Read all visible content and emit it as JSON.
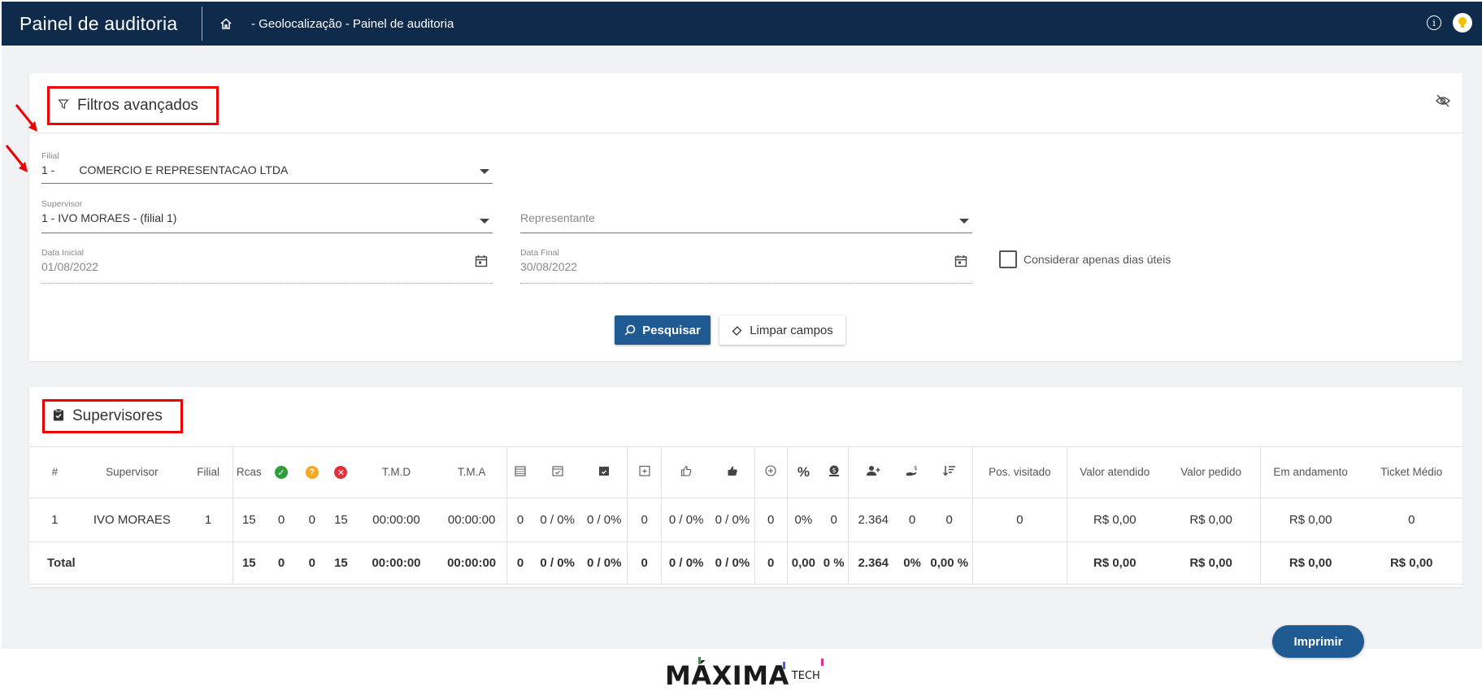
{
  "header": {
    "title": "Painel de auditoria",
    "breadcrumb": "- Geolocalização - Painel de auditoria",
    "bg_color": "#0f2b4c"
  },
  "filters": {
    "title": "Filtros avançados",
    "filial": {
      "label": "Filial",
      "code": "1 -",
      "name": "COMERCIO E REPRESENTACAO LTDA"
    },
    "supervisor": {
      "label": "Supervisor",
      "value": "1 - IVO MORAES - (filial 1)"
    },
    "representante": {
      "placeholder": "Representante"
    },
    "data_inicial": {
      "label": "Data Inicial",
      "value": "01/08/2022"
    },
    "data_final": {
      "label": "Data Final",
      "value": "30/08/2022"
    },
    "dias_uteis_label": "Considerar apenas dias úteis",
    "search_label": "Pesquisar",
    "clear_label": "Limpar campos"
  },
  "supervisores": {
    "title": "Supervisores",
    "columns": [
      "#",
      "Supervisor",
      "Filial",
      "Rcas",
      "check-circle-icon",
      "question-circle-icon",
      "x-circle-icon",
      "T.M.D",
      "T.M.A",
      "calendar-grid-icon",
      "calendar-check-icon",
      "calendar-filled-icon",
      "calendar-plus-icon",
      "thumb-up-outline-icon",
      "thumb-up-filled-icon",
      "plus-circle-icon",
      "percent-icon",
      "money-icon",
      "add-person-icon",
      "hand-money-icon",
      "sort-desc-icon",
      "Pos. visitado",
      "Valor atendido",
      "Valor pedido",
      "Em andamento",
      "Ticket Médio"
    ],
    "rows": [
      [
        "1",
        "IVO MORAES",
        "1",
        "15",
        "0",
        "0",
        "15",
        "00:00:00",
        "00:00:00",
        "0",
        "0 / 0%",
        "0 / 0%",
        "0",
        "0 / 0%",
        "0 / 0%",
        "0",
        "0%",
        "0",
        "2.364",
        "0",
        "0",
        "0",
        "R$ 0,00",
        "R$ 0,00",
        "R$ 0,00",
        "0"
      ]
    ],
    "total": [
      "Total",
      "",
      "",
      "15",
      "0",
      "0",
      "15",
      "00:00:00",
      "00:00:00",
      "0",
      "0 / 0%",
      "0 / 0%",
      "0",
      "0 / 0%",
      "0 / 0%",
      "0",
      "0,00",
      "0 %",
      "2.364",
      "0%",
      "0,00 %",
      "",
      "R$ 0,00",
      "R$ 0,00",
      "R$ 0,00",
      "R$ 0,00"
    ]
  },
  "print_label": "Imprimir",
  "footer": {
    "logo": "MÁXIMA",
    "logo_suffix": "TECH"
  },
  "colors": {
    "primary": "#1f5a93",
    "ok": "#2e9d3a",
    "warn": "#f5a623",
    "error": "#e0303a",
    "highlight": "#ee0000"
  }
}
